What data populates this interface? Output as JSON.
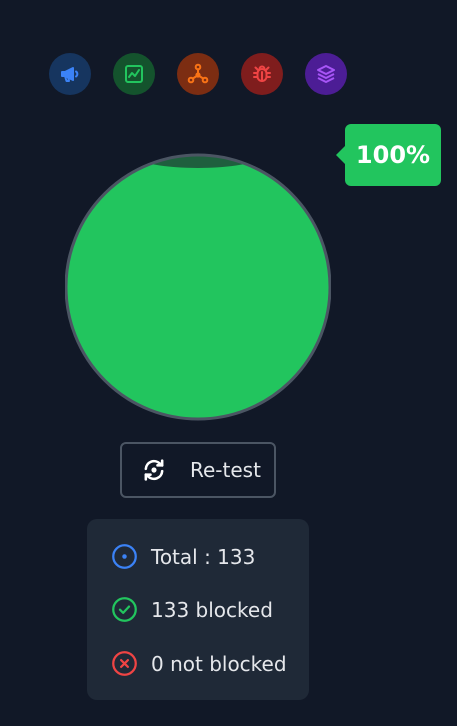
{
  "colors": {
    "background": "#111827",
    "gauge_fill": "#22c55e",
    "gauge_border": "#4b5563",
    "panel": "#1f2937",
    "text": "#e5e7eb"
  },
  "categories": [
    {
      "icon": "megaphone-icon",
      "color": "#3b82f6",
      "bg": "#16355f"
    },
    {
      "icon": "chart-line-icon",
      "color": "#22c55e",
      "bg": "#14532d"
    },
    {
      "icon": "network-nodes-icon",
      "color": "#f97316",
      "bg": "#7c2d12"
    },
    {
      "icon": "bug-icon",
      "color": "#ef4444",
      "bg": "#7f1d1d"
    },
    {
      "icon": "layers-icon",
      "color": "#a855f7",
      "bg": "#4c1d95"
    }
  ],
  "gauge": {
    "percent_label": "100%",
    "fill_fraction": 1.0
  },
  "retest_button": {
    "icon": "refresh-icon",
    "label": "Re-test"
  },
  "stats": {
    "total": {
      "icon": "target-icon",
      "color": "#3b82f6",
      "label": "Total : 133"
    },
    "blocked": {
      "icon": "check-circle-icon",
      "color": "#22c55e",
      "label": "133 blocked"
    },
    "not_blocked": {
      "icon": "x-circle-icon",
      "color": "#ef4444",
      "label": "0 not blocked"
    }
  }
}
